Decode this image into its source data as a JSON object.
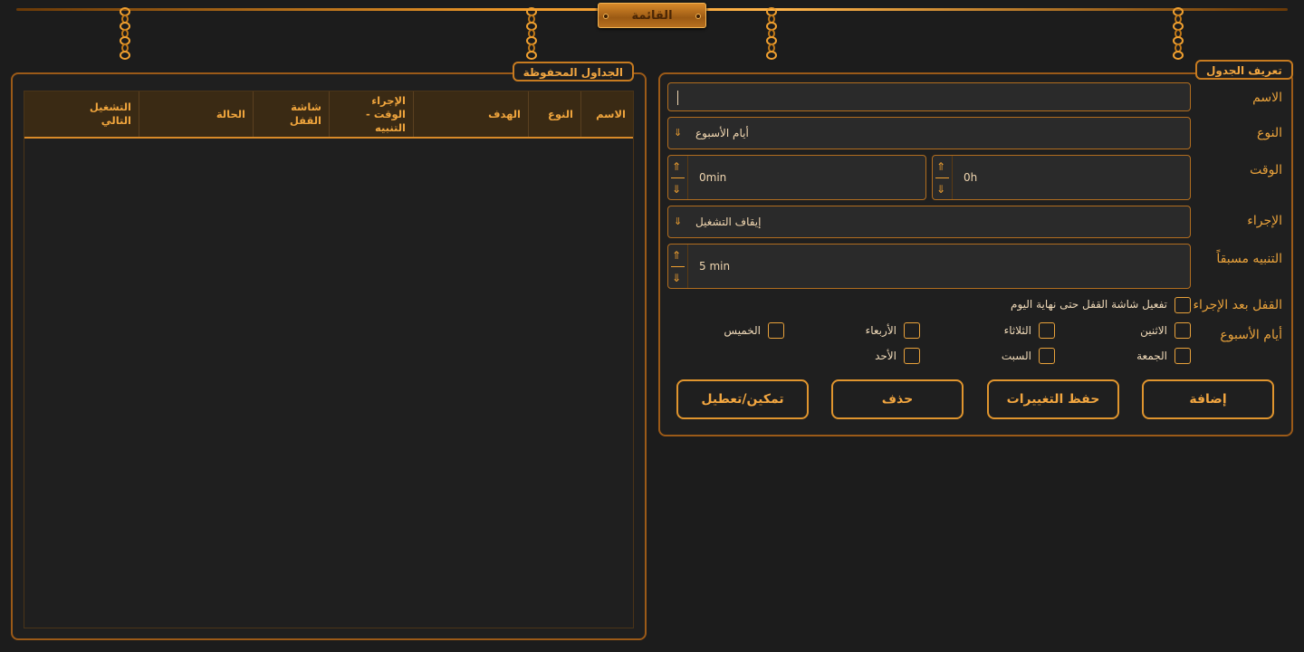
{
  "menu": {
    "title": "القائمة"
  },
  "saved_panel": {
    "title": "الجداول المحفوظة",
    "columns": [
      {
        "label": "الاسم"
      },
      {
        "label": "النوع"
      },
      {
        "label": "الهدف"
      },
      {
        "label": "الإجراء\nالوقت - التنبيه"
      },
      {
        "label": "شاشة القفل"
      },
      {
        "label": "الحالة"
      },
      {
        "label": "التشغيل\nالتالي"
      }
    ],
    "rows": []
  },
  "definition_panel": {
    "title": "تعريف الجدول",
    "name": {
      "label": "الاسم",
      "value": ""
    },
    "type": {
      "label": "النوع",
      "value": "أيام الأسبوع",
      "arrow": "⇓"
    },
    "time": {
      "label": "الوقت",
      "hours": "0h",
      "minutes": "0min"
    },
    "action": {
      "label": "الإجراء",
      "value": "إيقاف التشغيل",
      "arrow": "⇓"
    },
    "advance_alert": {
      "label": "التنبيه مسبقاً",
      "value": "5 min"
    },
    "spin_up": "⇑",
    "spin_down": "⇓",
    "lock_after": {
      "label": "القفل بعد الإجراء",
      "checkbox_label": "تفعيل شاشة القفل حتى نهاية اليوم",
      "checked": false
    },
    "weekdays": {
      "label": "أيام الأسبوع",
      "days": [
        {
          "label": "الاثنين",
          "checked": false
        },
        {
          "label": "الثلاثاء",
          "checked": false
        },
        {
          "label": "الأربعاء",
          "checked": false
        },
        {
          "label": "الخميس",
          "checked": false
        },
        {
          "label": "الجمعة",
          "checked": false
        },
        {
          "label": "السبت",
          "checked": false
        },
        {
          "label": "الأحد",
          "checked": false
        }
      ]
    },
    "buttons": {
      "add": "إضافة",
      "save": "حفظ التغييرات",
      "delete": "حذف",
      "toggle": "تمكين/تعطيل"
    }
  },
  "colors": {
    "accent": "#f0a030",
    "border": "#b16d1f",
    "background": "#1c1c1c"
  }
}
